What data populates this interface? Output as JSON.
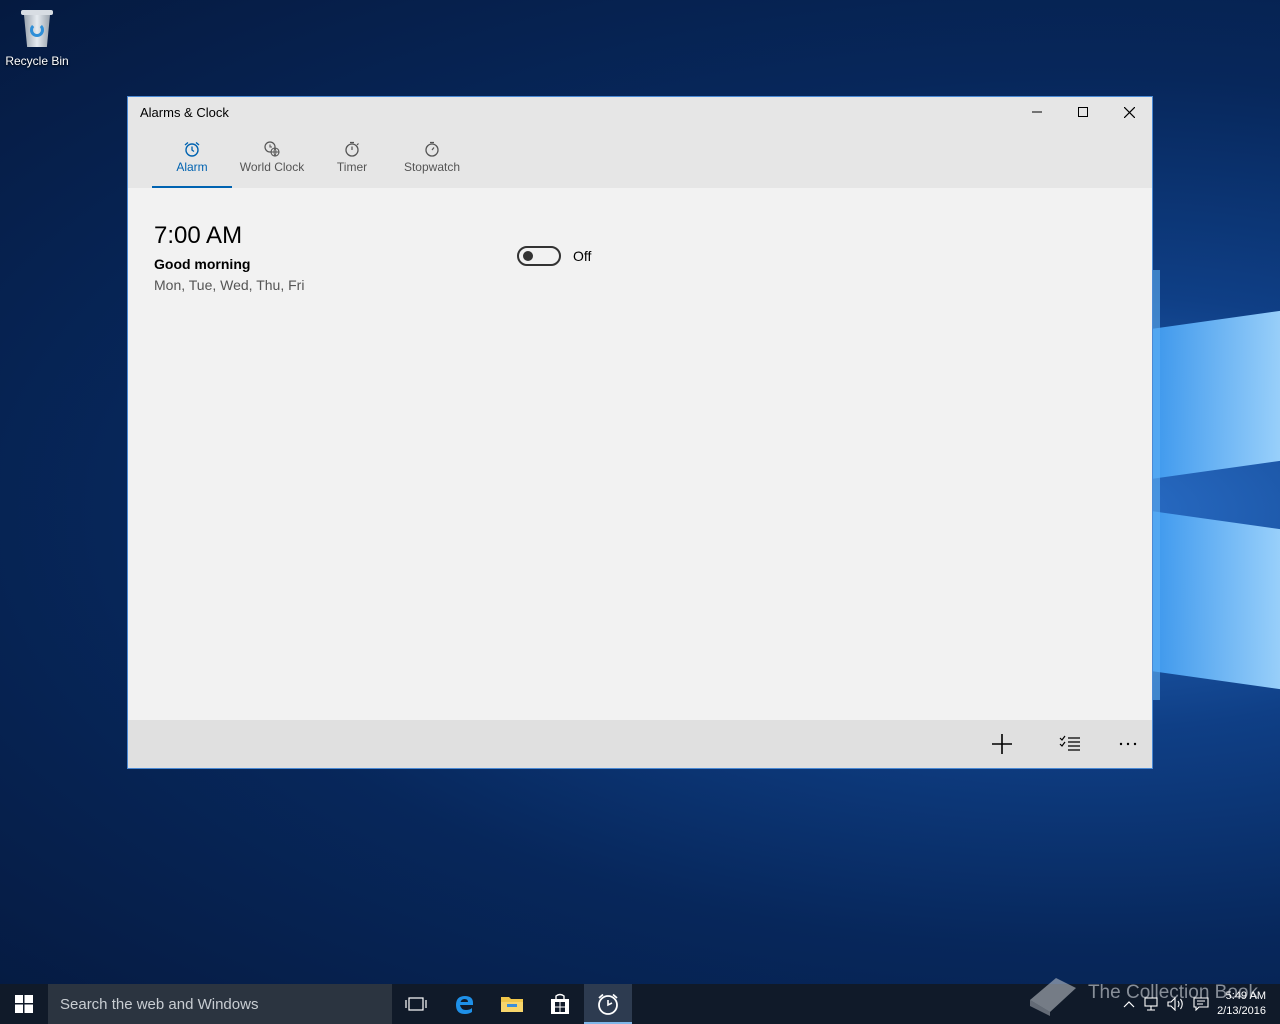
{
  "desktop": {
    "recycle_bin_label": "Recycle Bin"
  },
  "window": {
    "title": "Alarms & Clock",
    "tabs": [
      {
        "label": "Alarm",
        "icon": "alarm-clock-icon",
        "active": true
      },
      {
        "label": "World Clock",
        "icon": "world-clock-icon",
        "active": false
      },
      {
        "label": "Timer",
        "icon": "timer-icon",
        "active": false
      },
      {
        "label": "Stopwatch",
        "icon": "stopwatch-icon",
        "active": false
      }
    ],
    "alarm": {
      "time": "7:00 AM",
      "name": "Good morning",
      "days": "Mon, Tue, Wed, Thu, Fri",
      "toggle_state": "Off"
    },
    "commands": [
      "add-icon",
      "select-list-icon",
      "more-icon"
    ],
    "accent_color": "#0063b1"
  },
  "taskbar": {
    "search_placeholder": "Search the web and Windows",
    "clock_time": "5:49 AM",
    "clock_date": "2/13/2016",
    "watermark": "The Collection Book"
  }
}
